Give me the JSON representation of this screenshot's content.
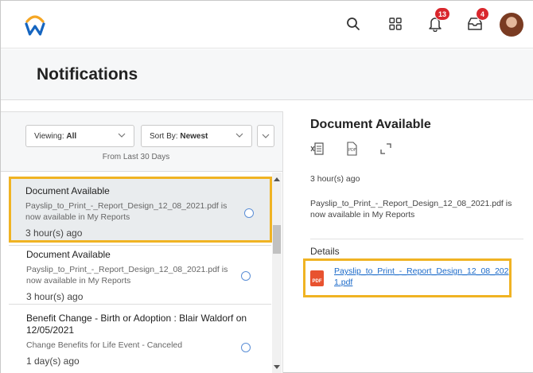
{
  "header": {
    "notification_count": "13",
    "inbox_count": "4",
    "colors": {
      "logo_orange": "#f5a623",
      "logo_blue": "#1565c0",
      "badge": "#d9262c"
    }
  },
  "page": {
    "title": "Notifications"
  },
  "filters": {
    "viewing_label": "Viewing:",
    "viewing_value": "All",
    "sort_label": "Sort By:",
    "sort_value": "Newest",
    "range_text": "From Last 30 Days"
  },
  "notifications": [
    {
      "title": "Document Available",
      "body": "Payslip_to_Print_-_Report_Design_12_08_2021.pdf is now available in My Reports",
      "time": "3 hour(s) ago"
    },
    {
      "title": "Document Available",
      "body": "Payslip_to_Print_-_Report_Design_12_08_2021.pdf is now available in My Reports",
      "time": "3 hour(s) ago"
    },
    {
      "title": "Benefit Change - Birth or Adoption : Blair Waldorf on 12/05/2021",
      "body": "Change Benefits for Life Event - Canceled",
      "time": "1 day(s) ago"
    }
  ],
  "detail": {
    "title": "Document Available",
    "time": "3 hour(s) ago",
    "body": "Payslip_to_Print_-_Report_Design_12_08_2021.pdf is now available in My Reports",
    "details_label": "Details",
    "file_icon_text": "PDF",
    "file_name": "Payslip_to_Print_-_Report_Design_12_08_2021.pdf"
  },
  "accent_colors": {
    "highlight": "#f0b323",
    "link": "#1b6ac9"
  }
}
